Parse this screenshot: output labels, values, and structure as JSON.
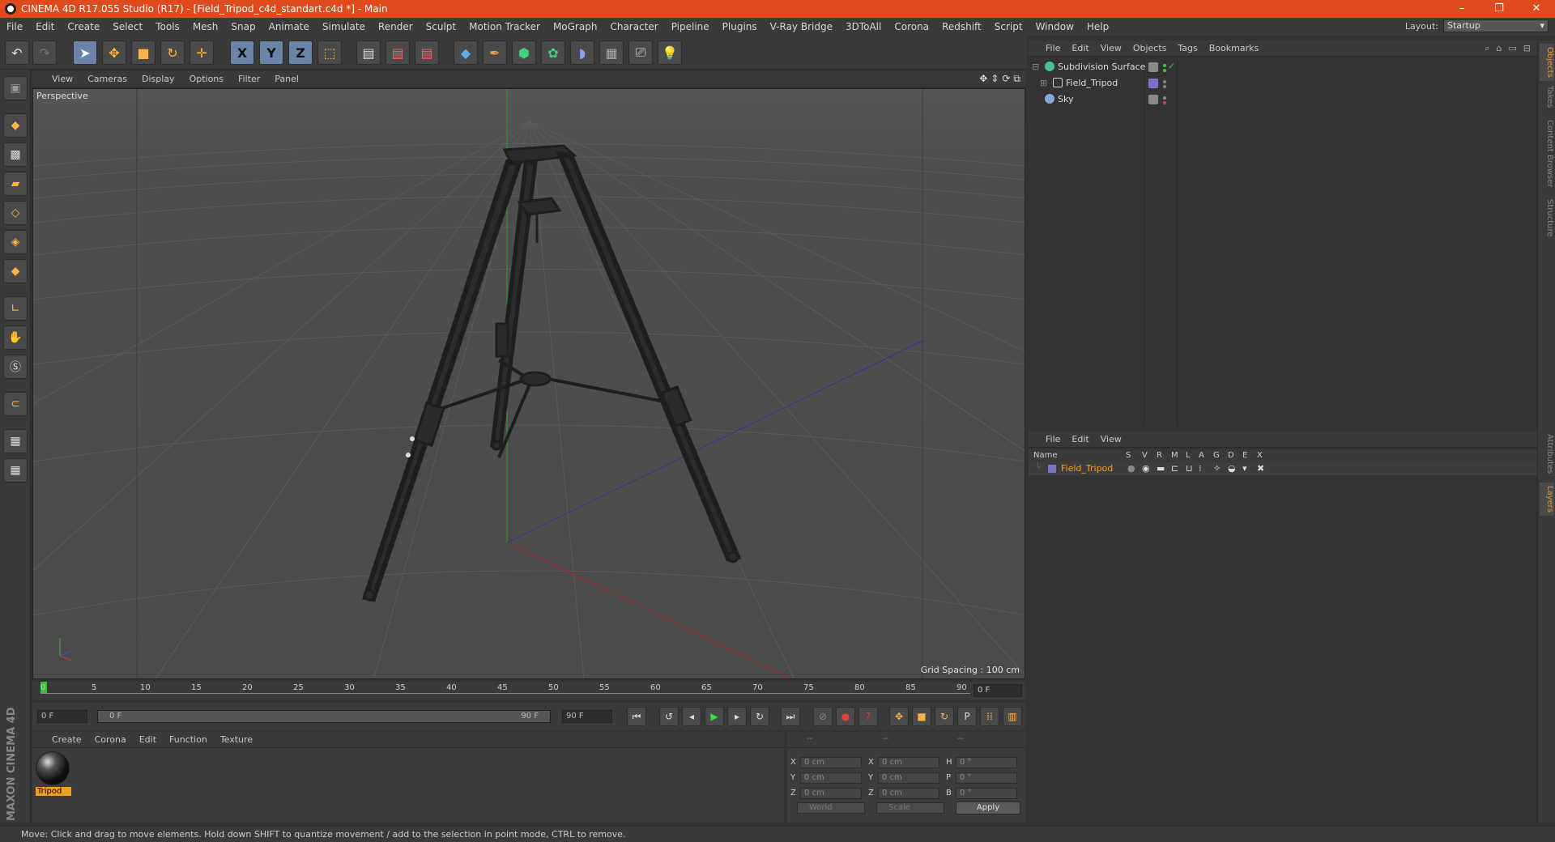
{
  "window": {
    "title": "CINEMA 4D R17.055 Studio (R17) - [Field_Tripod_c4d_standart.c4d *] - Main",
    "buttons": [
      "–",
      "❐",
      "✕"
    ]
  },
  "menubar": {
    "items": [
      "File",
      "Edit",
      "Create",
      "Select",
      "Tools",
      "Mesh",
      "Snap",
      "Animate",
      "Simulate",
      "Render",
      "Sculpt",
      "Motion Tracker",
      "MoGraph",
      "Character",
      "Pipeline",
      "Plugins",
      "V-Ray Bridge",
      "3DToAll",
      "Corona",
      "Redshift",
      "Script",
      "Window",
      "Help"
    ],
    "layout_label": "Layout:",
    "layout_value": "Startup"
  },
  "viewport": {
    "menu": [
      "View",
      "Cameras",
      "Display",
      "Options",
      "Filter",
      "Panel"
    ],
    "label": "Perspective",
    "grid_spacing": "Grid Spacing : 100 cm"
  },
  "timeline": {
    "ticks": [
      "0",
      "5",
      "10",
      "15",
      "20",
      "25",
      "30",
      "35",
      "40",
      "45",
      "50",
      "55",
      "60",
      "65",
      "70",
      "75",
      "80",
      "85",
      "90"
    ],
    "current_frame": "0 F"
  },
  "playback": {
    "start": "0 F",
    "range_start": "0 F",
    "range_end": "90 F",
    "end": "90 F"
  },
  "material_manager": {
    "menu": [
      "Create",
      "Corona",
      "Edit",
      "Function",
      "Texture"
    ],
    "materials": [
      {
        "name": "Tripod"
      }
    ]
  },
  "coordinates": {
    "header": [
      "--",
      "--",
      "--"
    ],
    "rows": [
      {
        "a": "X",
        "av": "0 cm",
        "b": "X",
        "bv": "0 cm",
        "c": "H",
        "cv": "0 °"
      },
      {
        "a": "Y",
        "av": "0 cm",
        "b": "Y",
        "bv": "0 cm",
        "c": "P",
        "cv": "0 °"
      },
      {
        "a": "Z",
        "av": "0 cm",
        "b": "Z",
        "bv": "0 cm",
        "c": "B",
        "cv": "0 °"
      }
    ],
    "space": "World",
    "mode": "Scale",
    "apply": "Apply"
  },
  "object_manager": {
    "menu": [
      "File",
      "Edit",
      "View",
      "Objects",
      "Tags",
      "Bookmarks"
    ],
    "objects": [
      {
        "name": "Subdivision Surface",
        "color": "#3fc38a"
      },
      {
        "name": "Field_Tripod",
        "color": "#7a8ab0"
      },
      {
        "name": "Sky",
        "color": "#8aa8d8"
      }
    ]
  },
  "layer_manager": {
    "menu": [
      "File",
      "Edit",
      "View"
    ],
    "columns": [
      "Name",
      "S",
      "V",
      "R",
      "M",
      "L",
      "A",
      "G",
      "D",
      "E",
      "X"
    ],
    "layers": [
      {
        "name": "Field_Tripod",
        "color": "#7a70d0"
      }
    ]
  },
  "side_tabs": [
    "Objects",
    "Takes",
    "Content Browser",
    "Structure",
    "Attributes",
    "Layers"
  ],
  "brand": "MAXON CINEMA 4D",
  "status": "Move: Click and drag to move elements. Hold down SHIFT to quantize movement / add to the selection in point mode, CTRL to remove."
}
